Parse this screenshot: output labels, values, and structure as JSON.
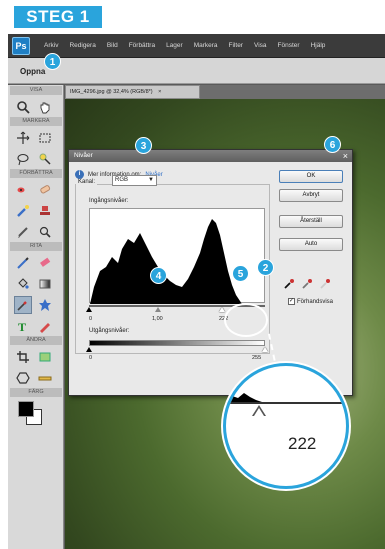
{
  "step_badge": "STEG 1",
  "menubar": {
    "app_icon": "photoshop-elements-icon",
    "items": [
      "Arkiv",
      "Redigera",
      "Bild",
      "Förbättra",
      "Lager",
      "Markera",
      "Filter",
      "Visa",
      "Fönster",
      "Hjälp"
    ]
  },
  "options_bar": {
    "label": "Oppna"
  },
  "toolbox": {
    "sections": [
      "VISA",
      "MARKERA",
      "FÖRBÄTTRA",
      "RITA",
      "ÄNDRA",
      "FÄRG"
    ]
  },
  "document": {
    "tab_label": "IMG_4296.jpg @ 32,4% (RGB/8*)",
    "tab_close": "×"
  },
  "dialog": {
    "title": "Nivåer",
    "close": "×",
    "info_text": "Mer information om:",
    "info_link": "Nivåer",
    "channel_label": "Kanal:",
    "channel_value": "RGB",
    "input_levels_label": "Ingångsnivåer:",
    "input_black": "0",
    "input_gamma": "1,00",
    "input_white": "222",
    "output_levels_label": "Utgångsnivåer:",
    "output_black": "0",
    "output_white": "255",
    "buttons": {
      "ok": "OK",
      "cancel": "Avbryt",
      "reset": "Återställ",
      "auto": "Auto"
    },
    "preview_label": "Förhandsvisa",
    "preview_checked": "✓"
  },
  "markers": [
    "1",
    "2",
    "3",
    "4",
    "5",
    "6"
  ],
  "zoom": {
    "value": "222"
  },
  "colors": {
    "accent": "#2aa4dc"
  }
}
